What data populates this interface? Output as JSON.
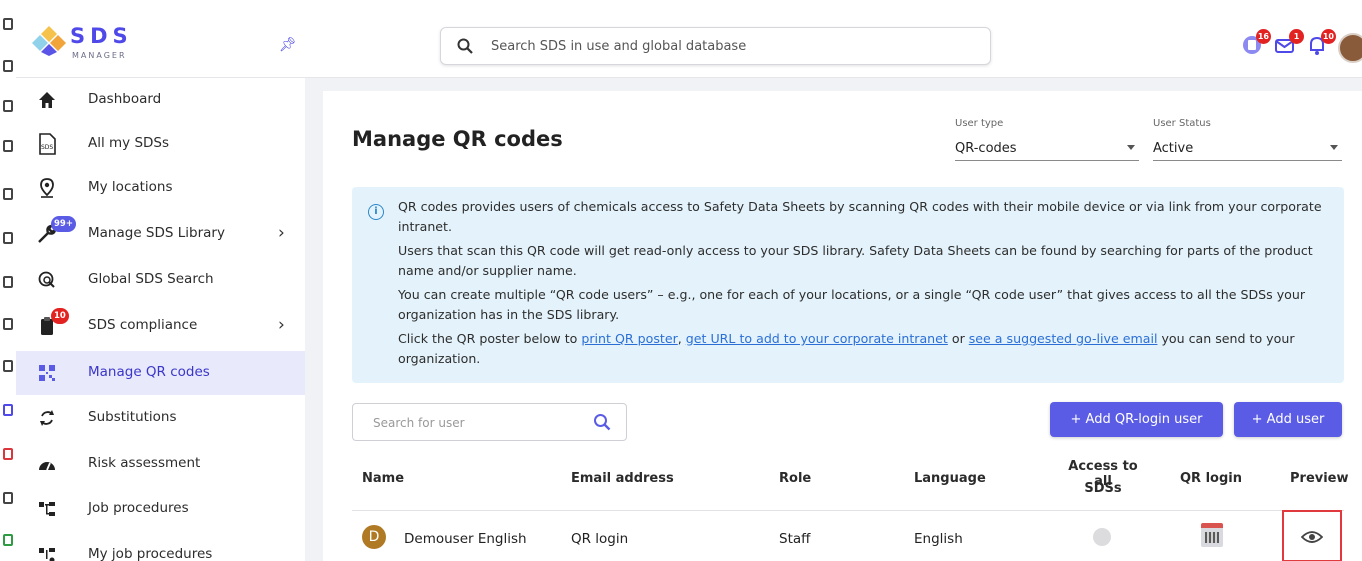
{
  "app": {
    "logo_text": "SDS",
    "logo_sub": "MANAGER"
  },
  "search": {
    "placeholder": "Search SDS in use and global database"
  },
  "topbar": {
    "badges": [
      {
        "icon": "sds-update-icon",
        "count": "16"
      },
      {
        "icon": "mail-icon",
        "count": "1"
      },
      {
        "icon": "bell-icon",
        "count": "10"
      }
    ]
  },
  "sidebar": {
    "items": [
      {
        "label": "Dashboard",
        "icon": "home-icon"
      },
      {
        "label": "All my SDSs",
        "icon": "sds-document-icon"
      },
      {
        "label": "My locations",
        "icon": "location-pin-icon"
      },
      {
        "label": "Manage SDS Library",
        "icon": "wrench-icon",
        "badge": "99+",
        "has_submenu": true
      },
      {
        "label": "Global SDS Search",
        "icon": "global-search-icon"
      },
      {
        "label": "SDS compliance",
        "icon": "clipboard-icon",
        "badge": "10",
        "has_submenu": true
      },
      {
        "label": "Manage QR codes",
        "icon": "qr-code-icon",
        "active": true
      },
      {
        "label": "Substitutions",
        "icon": "substitution-icon"
      },
      {
        "label": "Risk assessment",
        "icon": "gauge-icon"
      },
      {
        "label": "Job procedures",
        "icon": "hierarchy-icon"
      },
      {
        "label": "My job procedures",
        "icon": "hierarchy-user-icon"
      }
    ]
  },
  "main": {
    "title": "Manage QR codes",
    "filters": {
      "user_type": {
        "label": "User type",
        "value": "QR-codes"
      },
      "user_status": {
        "label": "User Status",
        "value": "Active"
      }
    },
    "info": {
      "p1": "QR codes provides users of chemicals access to Safety Data Sheets by scanning QR codes with their mobile device or via link from your corporate intranet.",
      "p2": "Users that scan this QR code will get read-only access to your SDS library. Safety Data Sheets can be found by searching for parts of the product name and/or supplier name.",
      "p3": "You can create multiple “QR code users” – e.g., one for each of your locations, or a single “QR code user” that gives access to all the SDSs your organization has in the SDS library.",
      "p4_pre": "Click the QR poster below to ",
      "link1": "print QR poster",
      "sep1": ", ",
      "link2": "get URL to add to your corporate intranet",
      "sep2": " or ",
      "link3": "see a suggested go-live email",
      "p4_post": " you can send to your organization."
    },
    "user_search": {
      "placeholder": "Search for user"
    },
    "buttons": {
      "add_qr": "+  Add QR-login user",
      "add_user": "+  Add user"
    },
    "table": {
      "headers": {
        "name": "Name",
        "email": "Email address",
        "role": "Role",
        "language": "Language",
        "access_1": "Access to all",
        "access_2": "SDSs",
        "qr_login": "QR login",
        "preview": "Preview"
      },
      "rows": [
        {
          "initial": "D",
          "name": "Demouser English",
          "email": "QR login",
          "role": "Staff",
          "language": "English"
        }
      ]
    }
  },
  "colors": {
    "accent": "#5b5ce6",
    "active_bg": "#e8e9fb",
    "info_bg": "#e4f3fb",
    "badge": "#e32222"
  }
}
